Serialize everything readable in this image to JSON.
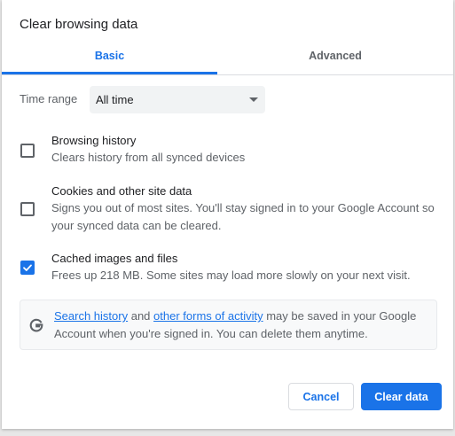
{
  "dialog": {
    "title": "Clear browsing data"
  },
  "tabs": [
    {
      "label": "Basic",
      "selected": true
    },
    {
      "label": "Advanced",
      "selected": false
    }
  ],
  "time_range": {
    "label": "Time range",
    "selected": "All time"
  },
  "options": [
    {
      "title": "Browsing history",
      "description": "Clears history from all synced devices",
      "checked": false
    },
    {
      "title": "Cookies and other site data",
      "description": "Signs you out of most sites. You'll stay signed in to your Google Account so your synced data can be cleared.",
      "checked": false
    },
    {
      "title": "Cached images and files",
      "description": "Frees up 218 MB. Some sites may load more slowly on your next visit.",
      "checked": true
    }
  ],
  "info": {
    "icon": "google-g-icon",
    "link1": "Search history",
    "and": "and",
    "link2": "other forms of activity",
    "rest": "may be saved in your Google Account when you're signed in. You can delete them anytime."
  },
  "buttons": {
    "cancel": "Cancel",
    "clear": "Clear data"
  },
  "colors": {
    "accent": "#1a73e8",
    "text": "#202124",
    "secondary_text": "#5f6368"
  }
}
